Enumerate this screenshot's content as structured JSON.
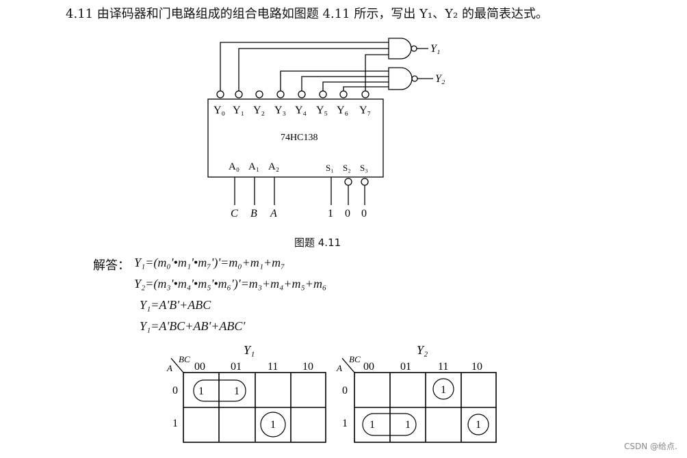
{
  "problem_text": "4.11  由译码器和门电路组成的组合电路如图题 4.11 所示，写出 Y₁、Y₂ 的最简表达式。",
  "circuit": {
    "outputs": [
      "Y₀",
      "Y₁",
      "Y₂",
      "Y₃",
      "Y₄",
      "Y₅",
      "Y₆",
      "Y₇"
    ],
    "chip_name": "74HC138",
    "address_inputs": [
      "A₀",
      "A₁",
      "A₂"
    ],
    "enable_inputs": [
      "S₁",
      "S₂",
      "S₃"
    ],
    "address_signals": [
      "C",
      "B",
      "A"
    ],
    "enable_values": [
      "1",
      "0",
      "0"
    ],
    "gate_outputs": [
      "Y₁",
      "Y₂"
    ]
  },
  "figure_caption": "图题 4.11",
  "answer": {
    "label": "解答：",
    "eq1": "Y₁=(m₀'•m₁'•m₇')'=m₀+m₁+m₇",
    "eq2": "Y₂=(m₃'•m₄'•m₅'•m₆')'=m₃+m₄+m₅+m₆",
    "eq3": "Y₁=A'B'+ABC",
    "eq4": "Y₁=A'BC+AB'+ABC'"
  },
  "kmaps": [
    {
      "title": "Y₁",
      "row_var": "A",
      "col_var": "BC",
      "col_labels": [
        "00",
        "01",
        "11",
        "10"
      ],
      "row_labels": [
        "0",
        "1"
      ],
      "cells": [
        [
          "1",
          "1",
          "",
          ""
        ],
        [
          "",
          "",
          "1",
          ""
        ]
      ]
    },
    {
      "title": "Y₂",
      "row_var": "A",
      "col_var": "BC",
      "col_labels": [
        "00",
        "01",
        "11",
        "10"
      ],
      "row_labels": [
        "0",
        "1"
      ],
      "cells": [
        [
          "",
          "",
          "1",
          ""
        ],
        [
          "1",
          "1",
          "",
          "1"
        ]
      ]
    }
  ],
  "watermark": "CSDN @给点."
}
